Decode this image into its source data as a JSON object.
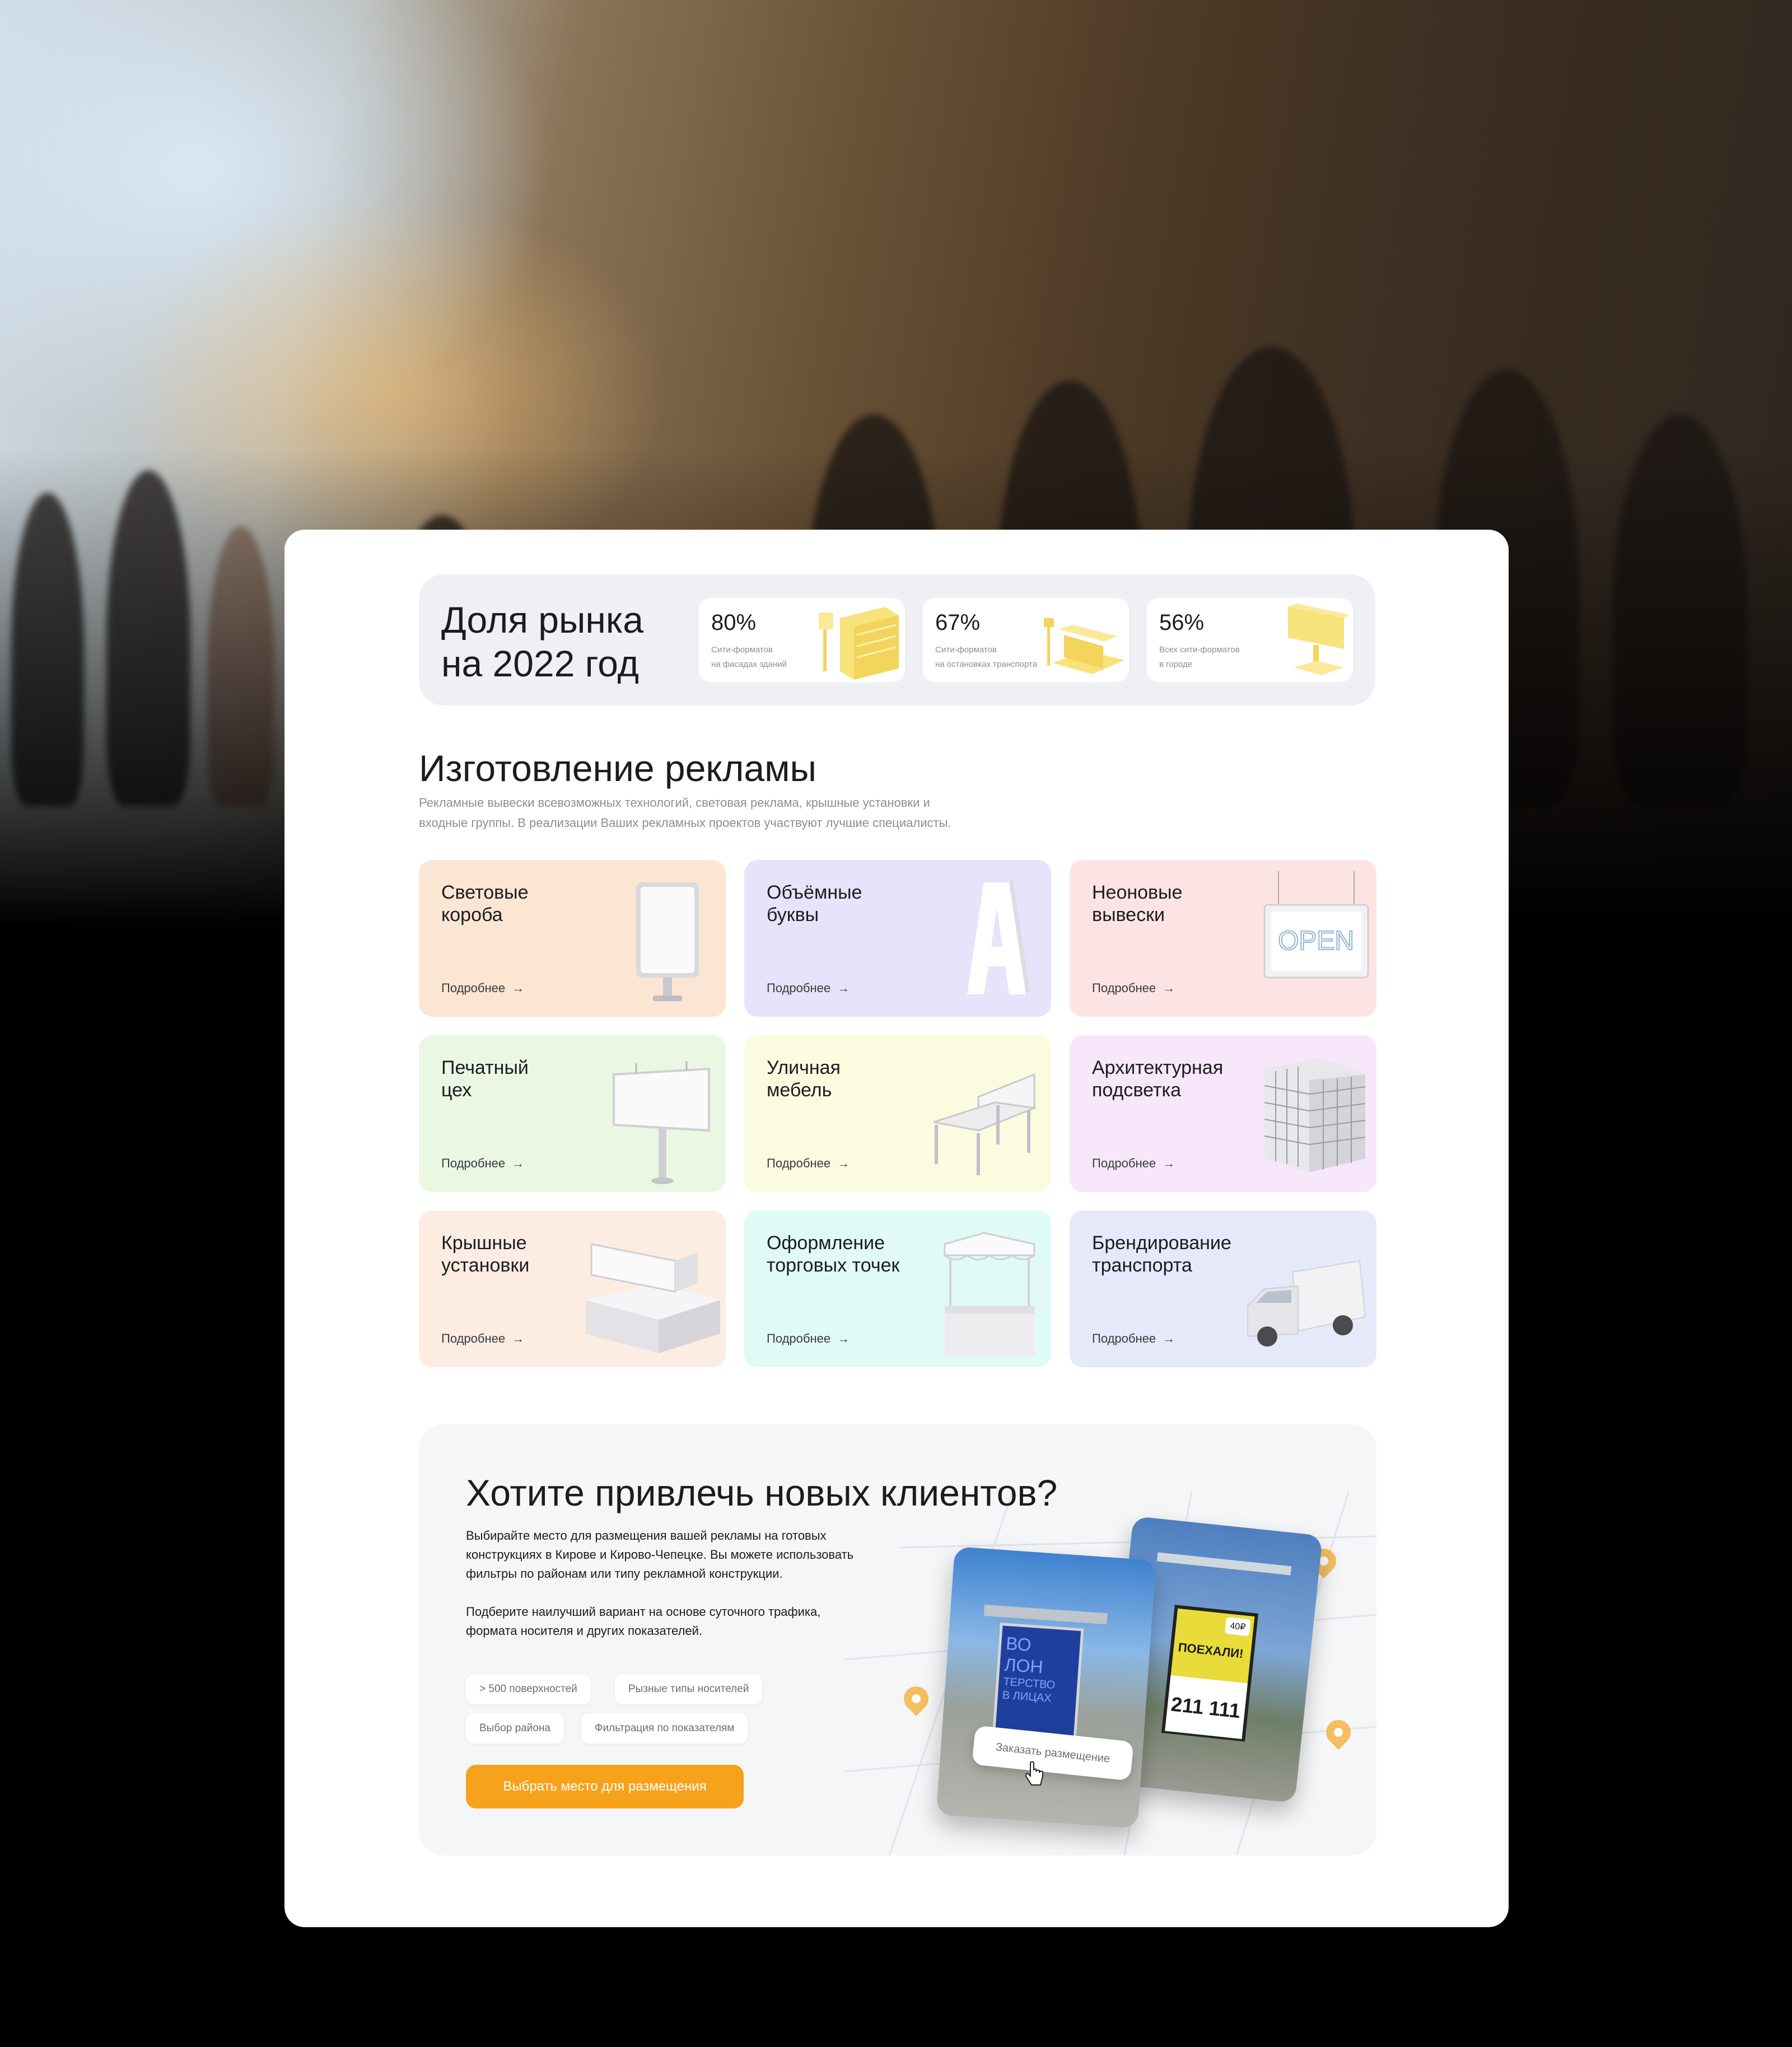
{
  "stats": {
    "title_line1": "Доля рынка",
    "title_line2": "на 2022 год",
    "items": [
      {
        "value": "80%",
        "line1": "Сити-форматов",
        "line2": "на фасадах зданий"
      },
      {
        "value": "67%",
        "line1": "Сити-форматов",
        "line2": "на остановках транспорта"
      },
      {
        "value": "56%",
        "line1": "Всех сити-форматов",
        "line2": "в городе"
      }
    ]
  },
  "section": {
    "title": "Изготовление рекламы",
    "desc_line1": "Рекламные вывески всевозможных технологий, световая реклама, крышные установки и",
    "desc_line2": "входные группы. В реализации Ваших рекламных проектов участвуют лучшие специалисты."
  },
  "tiles": [
    {
      "line1": "Световые",
      "line2": "короба",
      "more": "Подробнее",
      "bg": "#fbe5d3"
    },
    {
      "line1": "Объёмные",
      "line2": "буквы",
      "more": "Подробнее",
      "bg": "#e6e3fa"
    },
    {
      "line1": "Неоновые",
      "line2": "вывески",
      "more": "Подробнее",
      "bg": "#fde4e4"
    },
    {
      "line1": "Печатный",
      "line2": "цех",
      "more": "Подробнее",
      "bg": "#eaf8e3"
    },
    {
      "line1": "Уличная",
      "line2": "мебель",
      "more": "Подробнее",
      "bg": "#fafbdf"
    },
    {
      "line1": "Архитектурная",
      "line2": "подсветка",
      "more": "Подробнее",
      "bg": "#f8e6fb"
    },
    {
      "line1": "Крышные",
      "line2": "установки",
      "more": "Подробнее",
      "bg": "#fdece2"
    },
    {
      "line1": "Оформление",
      "line2": "торговых точек",
      "more": "Подробнее",
      "bg": "#e0faf5"
    },
    {
      "line1": "Брендирование",
      "line2": "транспорта",
      "more": "Подробнее",
      "bg": "#e5e9fa"
    }
  ],
  "promo": {
    "title": "Хотите привлечь новых клиентов?",
    "p1_line1": "Выбирайте место для размещения вашей рекламы на готовых",
    "p1_line2": "конструкциях в Кирове и Кирово-Чепецке. Вы можете использовать",
    "p1_line3": "фильтры по районам или типу рекламной конструкции.",
    "p2_line1": "Подберите наилучший вариант на основе суточного трафика,",
    "p2_line2": "формата носителя и других показателей.",
    "chips": [
      "> 500 поверхностей",
      "Рызные типы носителей",
      "Выбор района",
      "Фильтрация по показателям"
    ],
    "cta": "Выбрать место для размещения",
    "order_btn": "Заказать размещение",
    "poster1_l1": "ВО",
    "poster1_l2": "ЛОН",
    "poster1_l3": "ТЕРСТВО",
    "poster1_l4": "В ЛИЦАХ",
    "poster2_badge": "40₽",
    "poster2_brand": "ПОЕХАЛИ!",
    "poster2_phone": "211 111"
  },
  "colors": {
    "accent": "#f7a21b",
    "art_yellow": "#f8e27a"
  }
}
